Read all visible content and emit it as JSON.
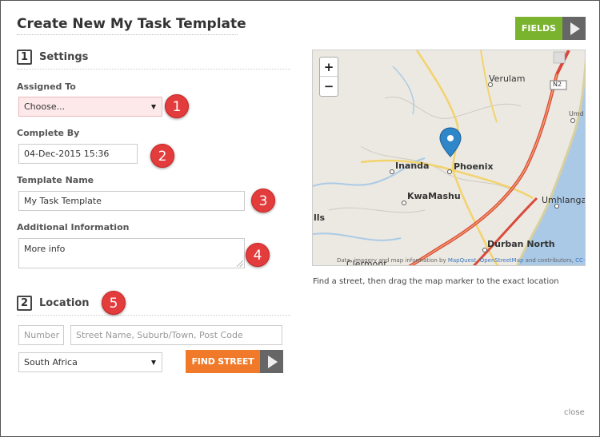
{
  "dialog": {
    "title": "Create New My Task Template",
    "fields_button": "FIELDS",
    "close_label": "close"
  },
  "settings": {
    "number": "1",
    "heading": "Settings",
    "assigned_to": {
      "label": "Assigned To",
      "value": "Choose..."
    },
    "complete_by": {
      "label": "Complete By",
      "value": "04-Dec-2015 15:36"
    },
    "template_name": {
      "label": "Template Name",
      "value": "My Task Template"
    },
    "additional_info": {
      "label": "Additional Information",
      "value": "More info"
    }
  },
  "location": {
    "number": "2",
    "heading": "Location",
    "number_placeholder": "Number",
    "street_placeholder": "Street Name, Suburb/Town, Post Code",
    "country_value": "South Africa",
    "find_button": "FIND STREET"
  },
  "annotations": [
    "1",
    "2",
    "3",
    "4",
    "5"
  ],
  "map": {
    "zoom_in": "+",
    "zoom_out": "−",
    "places": [
      "Verulam",
      "Phoenix",
      "Inanda",
      "KwaMashu",
      "Umhlanga I",
      "Durban North",
      "Umd",
      "lls",
      "Clermont"
    ],
    "road_shield": "N2",
    "attribution_prefix": "Data, imagery and map information by ",
    "attribution_mapquest": "MapQuest",
    "attribution_osm": "OpenStreetMap",
    "attribution_mid": " and contributors, ",
    "attribution_license": "CC-BY-SA",
    "hint": "Find a street, then drag the map marker to the exact location"
  },
  "colors": {
    "fields_green": "#7ab32e",
    "find_orange": "#f07a29",
    "badge_red": "#e33c3c",
    "pink_field": "#fde9ea",
    "marker_blue": "#2f86c9"
  }
}
